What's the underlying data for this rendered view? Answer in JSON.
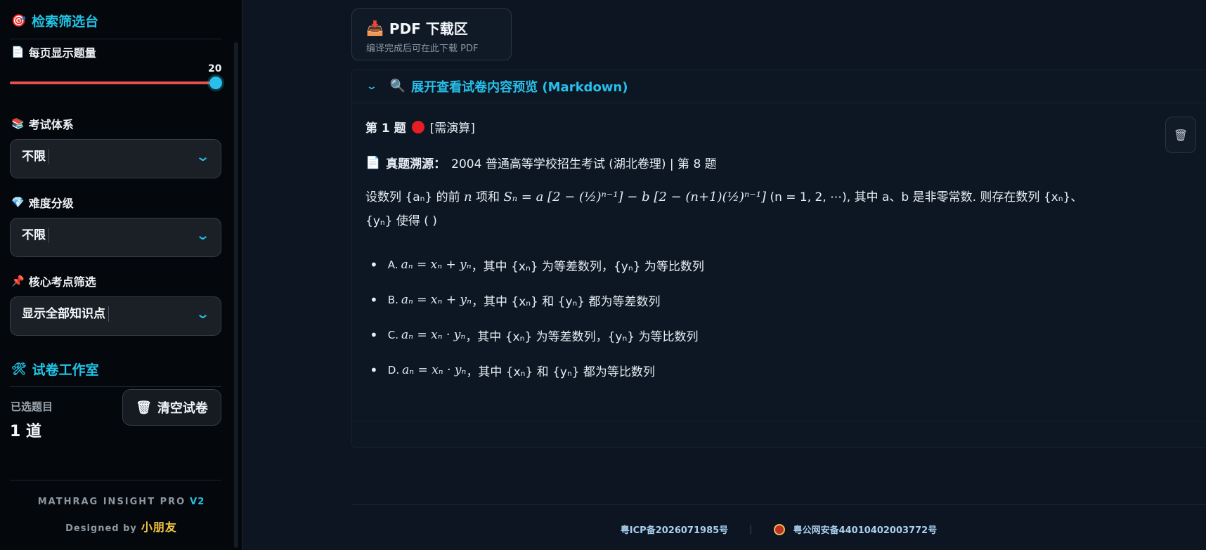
{
  "sidebar": {
    "filter_title": "检索筛选台",
    "per_page_label": "每页显示题量",
    "per_page_value": "20",
    "exam_system_label": "考试体系",
    "exam_system_value": "不限",
    "difficulty_label": "难度分级",
    "difficulty_value": "不限",
    "core_label": "核心考点筛选",
    "core_value": "显示全部知识点",
    "studio_title": "试卷工作室",
    "selected_label": "已选题目",
    "selected_count": "1 道",
    "clear_button": "清空试卷",
    "brand": "MATHRAG INSIGHT PRO",
    "version": "V2",
    "designed_by": "Designed by",
    "designer": "小朋友"
  },
  "main": {
    "download_title": "PDF 下载区",
    "download_sub": "编译完成后可在此下载 PDF",
    "expander_title": "展开查看试卷内容预览 (Markdown)",
    "question": {
      "number": "第 1 题",
      "tag": "[需演算]",
      "source_label": "真题溯源：",
      "source": "2004 普通高等学校招生考试 (湖北卷理) | 第 8 题",
      "stem_a": "设数列 {aₙ} 的前 ",
      "stem_b": "n",
      "stem_c": " 项和 ",
      "stem_formula": "Sₙ = a [2 − (½)ⁿ⁻¹] − b [2 − (n+1)(½)ⁿ⁻¹]",
      "stem_d": " (n = 1, 2, ⋯), 其中 a、b 是非零常数. 则存在数列 {xₙ}、",
      "stem_e": "{yₙ} 使得 ( )",
      "options": [
        {
          "letter": "A.",
          "math": "aₙ = xₙ + yₙ",
          "text": "，其中 {xₙ} 为等差数列，{yₙ} 为等比数列"
        },
        {
          "letter": "B.",
          "math": "aₙ = xₙ + yₙ",
          "text": "，其中 {xₙ} 和 {yₙ} 都为等差数列"
        },
        {
          "letter": "C.",
          "math": "aₙ = xₙ · yₙ",
          "text": "，其中 {xₙ} 为等差数列，{yₙ} 为等比数列"
        },
        {
          "letter": "D.",
          "math": "aₙ = xₙ · yₙ",
          "text": "，其中 {xₙ} 和 {yₙ} 都为等比数列"
        }
      ]
    }
  },
  "footer": {
    "icp": "粤ICP备2026071985号",
    "separator": "|",
    "police": "粤公网安备44010402003772号"
  },
  "colors": {
    "accent": "#27c0ec",
    "slider": "#e8504f",
    "dot": "#e41e24",
    "designer": "#f5c542"
  }
}
